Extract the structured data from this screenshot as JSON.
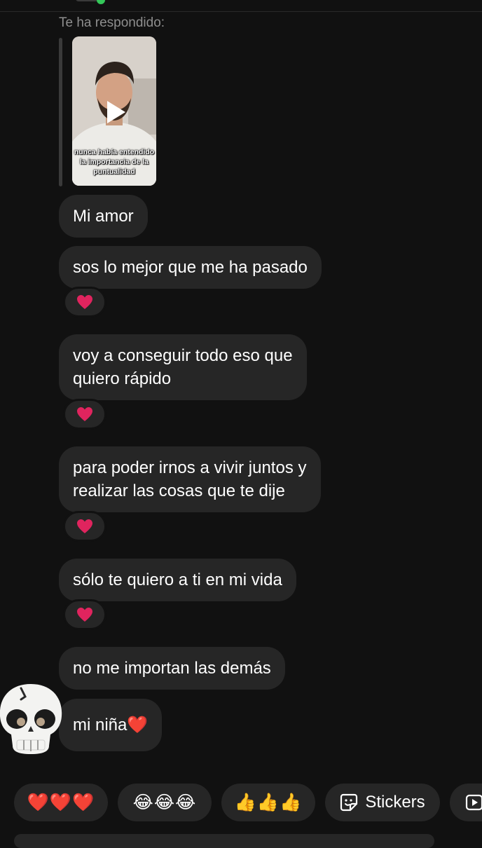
{
  "reply": {
    "label": "Te ha respondido:",
    "video_caption": "nunca había entendido la importancia de la puntualidad"
  },
  "messages": [
    {
      "text": "Mi amor",
      "reaction": null
    },
    {
      "text": "sos lo mejor que me ha pasado",
      "reaction": "❤️"
    },
    {
      "text": "voy a conseguir todo eso que\nquiero rápido",
      "reaction": "❤️"
    },
    {
      "text": "para poder irnos a vivir juntos y\nrealizar las cosas que te dije",
      "reaction": "❤️"
    },
    {
      "text": "sólo te quiero a ti en mi vida",
      "reaction": "❤️"
    },
    {
      "text": "no me importan las demás",
      "reaction": null
    },
    {
      "text": "mi niña❤️",
      "reaction": null
    }
  ],
  "avatar": {
    "icon": "skull-icon"
  },
  "quick_reactions": [
    {
      "label": "❤️❤️❤️"
    },
    {
      "label": "😂😂😂"
    },
    {
      "label": "👍👍👍"
    },
    {
      "label": "Stickers",
      "icon": "sticker-icon"
    },
    {
      "label": "",
      "icon": "video-icon"
    }
  ],
  "colors": {
    "background": "#111111",
    "bubble": "#262626",
    "heart": "#e0245e",
    "muted_text": "#8e8e8e"
  }
}
